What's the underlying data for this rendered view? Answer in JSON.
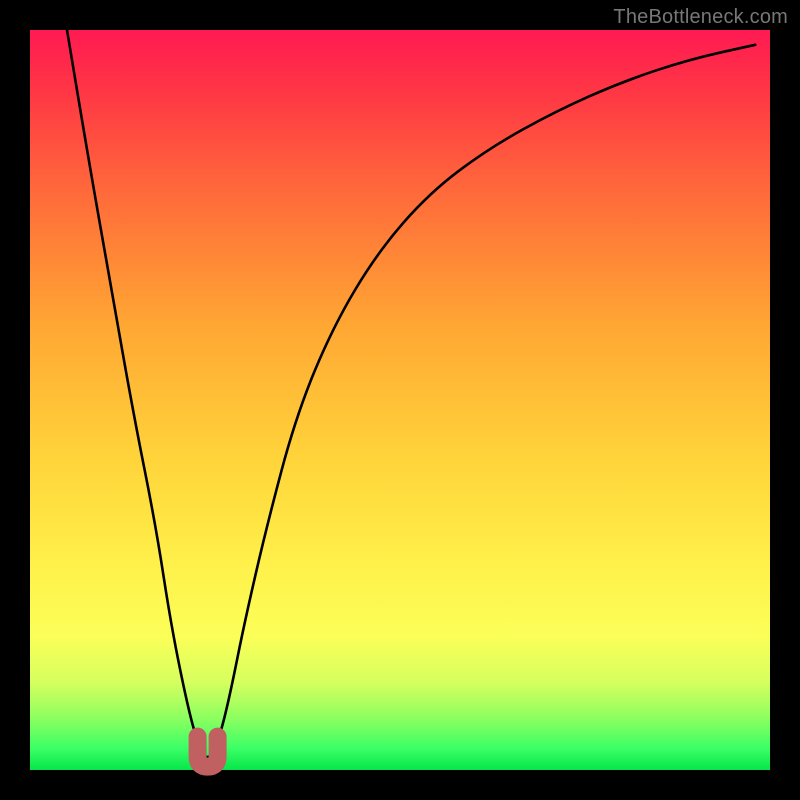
{
  "watermark": "TheBottleneck.com",
  "chart_data": {
    "type": "line",
    "title": "",
    "xlabel": "",
    "ylabel": "",
    "xlim": [
      0,
      100
    ],
    "ylim": [
      0,
      100
    ],
    "grid": false,
    "legend": false,
    "annotations": [],
    "series": [
      {
        "name": "bottleneck-curve",
        "color": "#000000",
        "x": [
          5,
          8,
          11,
          14,
          17,
          19,
          21,
          22.5,
          24,
          25.5,
          27,
          29,
          32,
          36,
          41,
          47,
          54,
          62,
          71,
          80,
          89,
          98
        ],
        "values": [
          100,
          82,
          65,
          48,
          33,
          20,
          10,
          4,
          1,
          4,
          10,
          20,
          33,
          48,
          60,
          70,
          78,
          84,
          89,
          93,
          96,
          98
        ]
      }
    ],
    "marker": {
      "name": "optimum-marker",
      "color": "#c16060",
      "x": 24,
      "y": 1,
      "shape": "U"
    }
  }
}
